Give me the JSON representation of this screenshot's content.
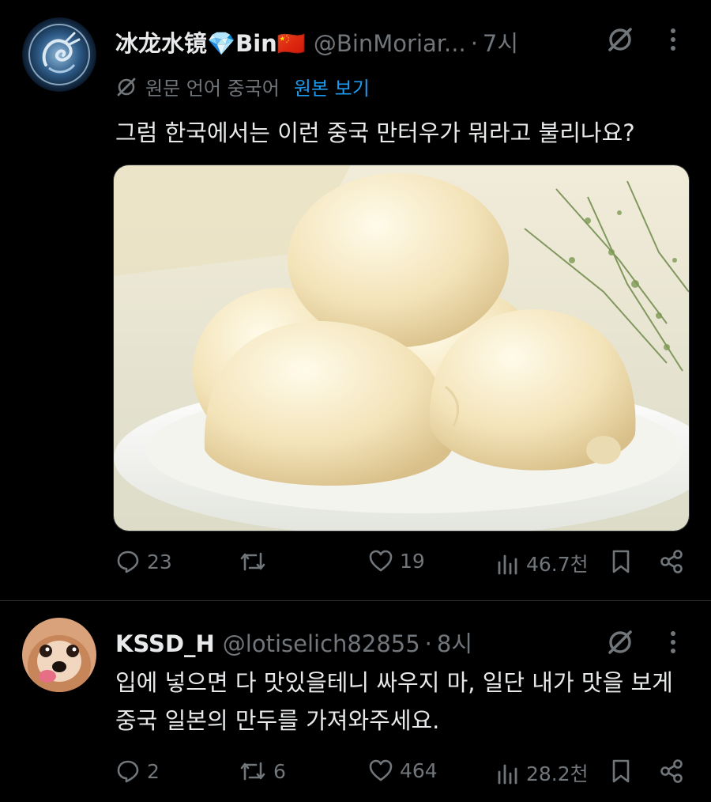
{
  "tweets": [
    {
      "display_name": "冰龙水镜💎Bin🇨🇳",
      "handle": "@BinMoriar...",
      "separator": "·",
      "time": "7시",
      "translate": {
        "label": "원문 언어 중국어",
        "link": "원본 보기"
      },
      "text": "그럼 한국에서는 이런 중국 만터우가 뭐라고 불리나요?",
      "media": "steamed-buns-photo",
      "actions": {
        "replies": "23",
        "reposts": "",
        "likes": "19",
        "views": "46.7천"
      }
    },
    {
      "display_name": "KSSD_H",
      "handle": "@lotiselich82855",
      "separator": "·",
      "time": "8시",
      "text": "입에 넣으면 다 맛있을테니 싸우지 마, 일단 내가 맛을 보게 중국 일본의 만두를 가져와주세요.",
      "actions": {
        "replies": "2",
        "reposts": "6",
        "likes": "464",
        "views": "28.2천"
      }
    }
  ],
  "icons": [
    "grok-icon",
    "more-icon",
    "reply-icon",
    "repost-icon",
    "like-icon",
    "views-icon",
    "bookmark-icon",
    "share-icon",
    "translate-icon"
  ],
  "colors": {
    "background": "#000000",
    "text": "#e7e9ea",
    "muted": "#71767b",
    "link": "#1d9bf0",
    "divider": "#2f3336"
  }
}
